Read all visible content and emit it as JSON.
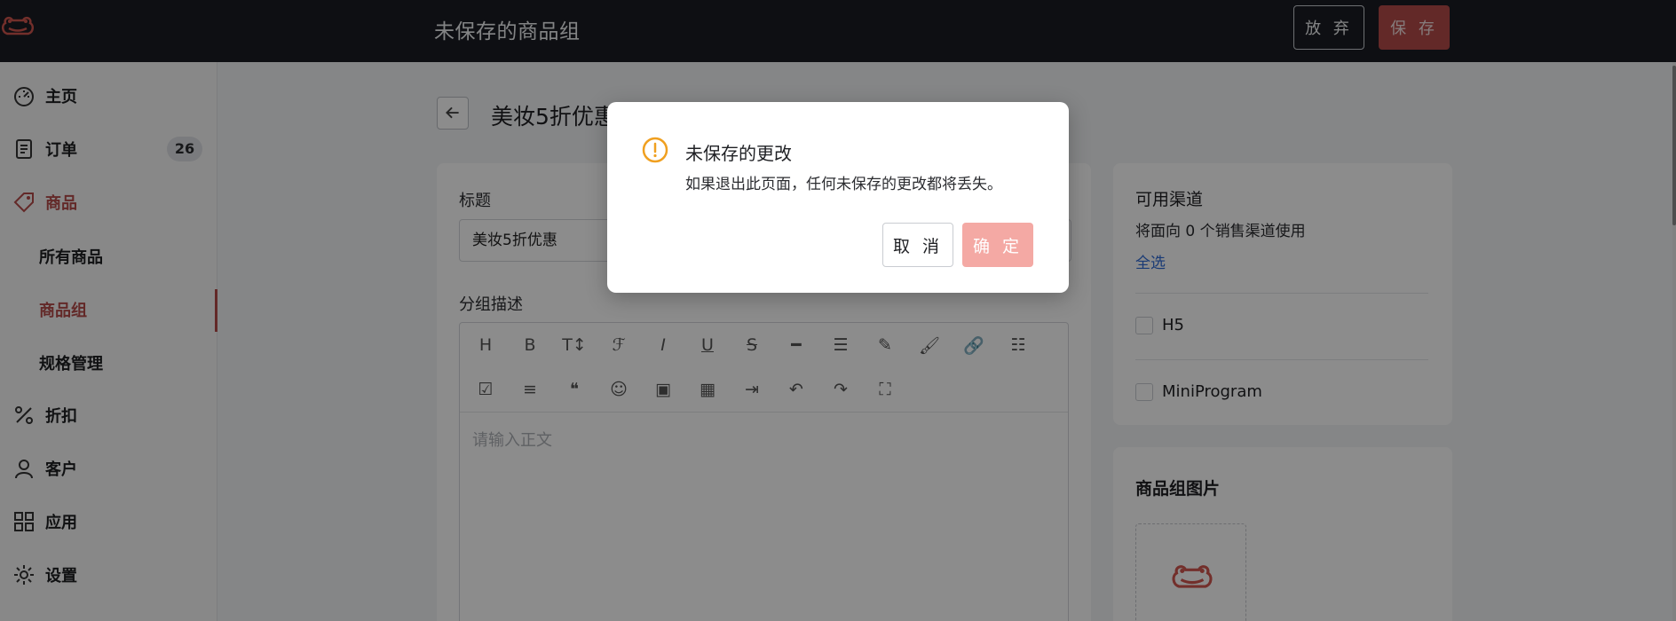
{
  "header": {
    "title": "未保存的商品组",
    "discard_label": "放 弃",
    "save_label": "保 存"
  },
  "sidebar": {
    "items": [
      {
        "label": "主页",
        "icon": "dashboard-icon"
      },
      {
        "label": "订单",
        "icon": "order-icon",
        "badge": "26"
      },
      {
        "label": "商品",
        "icon": "tag-icon"
      },
      {
        "label": "所有商品"
      },
      {
        "label": "商品组"
      },
      {
        "label": "规格管理"
      },
      {
        "label": "折扣",
        "icon": "percent-icon"
      },
      {
        "label": "客户",
        "icon": "user-icon"
      },
      {
        "label": "应用",
        "icon": "apps-icon"
      },
      {
        "label": "设置",
        "icon": "gear-icon"
      }
    ]
  },
  "main": {
    "page_title": "美妆5折优惠",
    "title_label": "标题",
    "title_value": "美妆5折优惠",
    "desc_label": "分组描述",
    "editor_placeholder": "请输入正文"
  },
  "side": {
    "channels_title": "可用渠道",
    "channels_sub": "将面向 0 个销售渠道使用",
    "select_all": "全选",
    "channels": [
      "H5",
      "MiniProgram"
    ],
    "image_title": "商品组图片"
  },
  "modal": {
    "title": "未保存的更改",
    "message": "如果退出此页面，任何未保存的更改都将丢失。",
    "cancel_label": "取 消",
    "ok_label": "确 定"
  },
  "colors": {
    "brand": "#b54b4a",
    "warning": "#f0a020",
    "link": "#2f6bd6"
  }
}
